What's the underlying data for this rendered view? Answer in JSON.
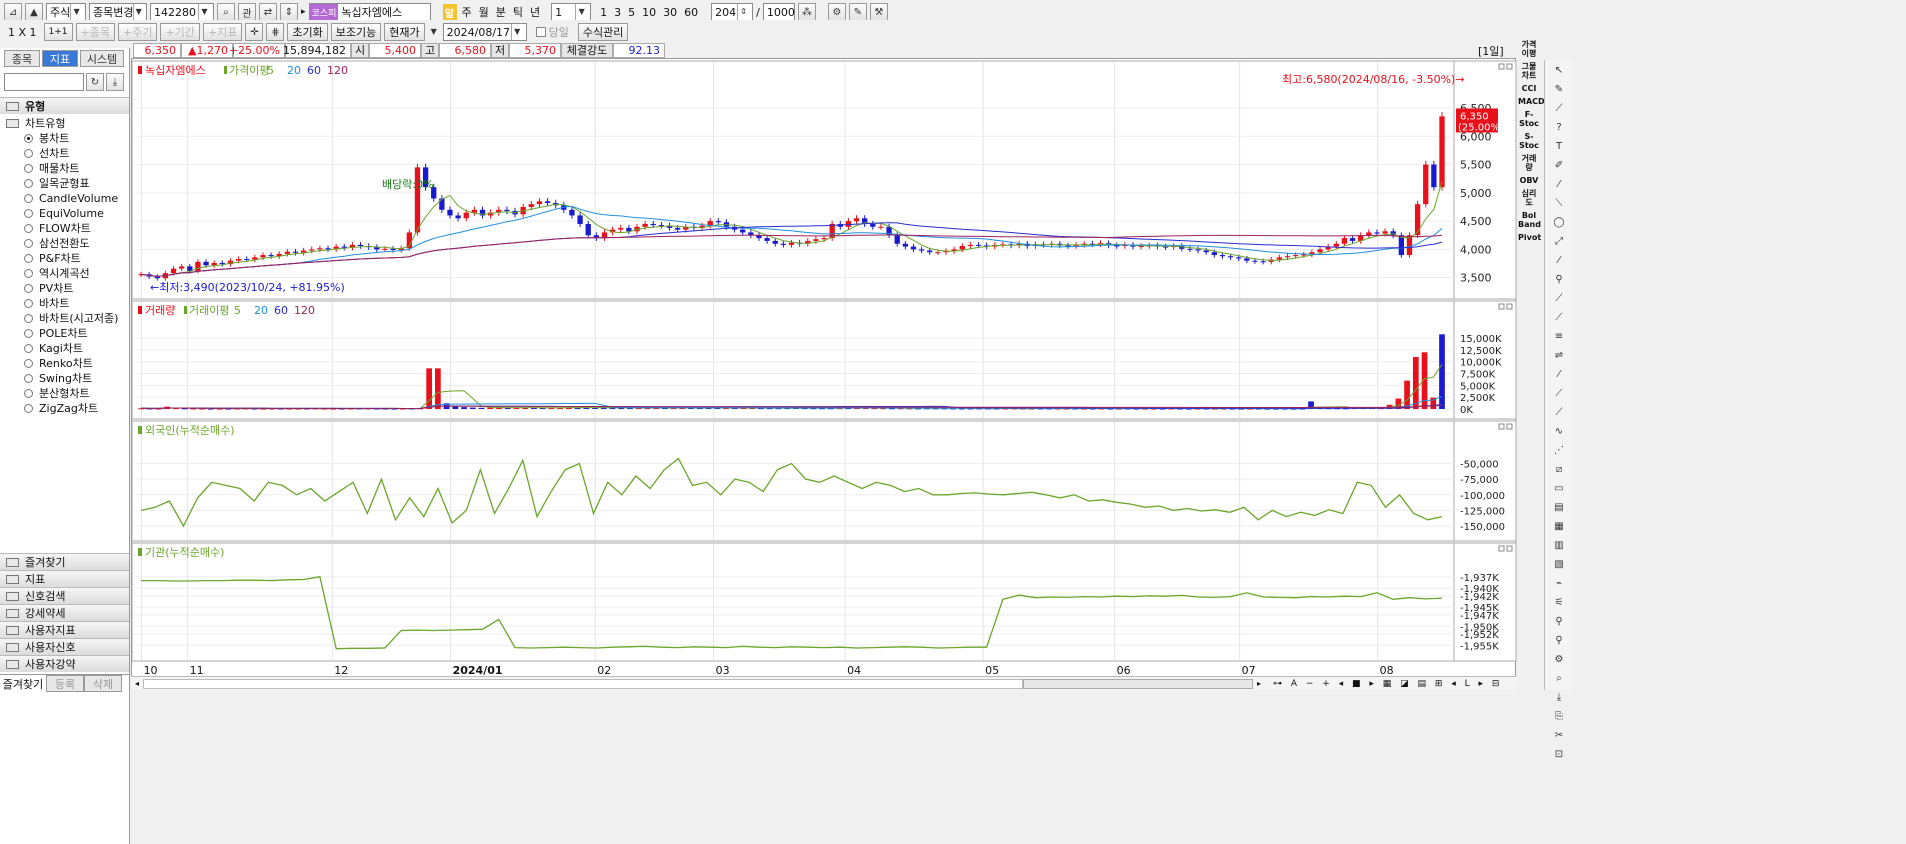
{
  "toolbar1": {
    "market": "주식",
    "code_change": "종목변경",
    "code": "142280",
    "related": "관",
    "market_tag": "코스피",
    "stock_name": "녹십자엠에스",
    "alert_tag": "알",
    "periods": [
      "주",
      "월",
      "분",
      "틱",
      "년"
    ],
    "period_value": "1",
    "intervals": [
      "1",
      "3",
      "5",
      "10",
      "30",
      "60"
    ],
    "count": "204",
    "total": "1000"
  },
  "toolbar2": {
    "layout": "1 X 1",
    "layout2": "1+1",
    "btn_item": "+종목",
    "btn_cycle": "+주기",
    "btn_period": "+기간",
    "btn_indicator": "+지표",
    "reset": "초기화",
    "aux": "보조기능",
    "current": "현재가",
    "date": "2024/08/17",
    "today_label": "당일",
    "formula": "수식관리"
  },
  "left_panel": {
    "tabs": [
      "종목",
      "지표",
      "시스템"
    ],
    "category": "유형",
    "tree_root": "차트유형",
    "chart_types": [
      "봉차트",
      "선차트",
      "매물차트",
      "일목균형표",
      "CandleVolume",
      "EquiVolume",
      "FLOW차트",
      "삼선전환도",
      "P&F차트",
      "역시계곡선",
      "PV차트",
      "바차트",
      "바차트(시고저종)",
      "POLE차트",
      "Kagi차트",
      "Renko차트",
      "Swing차트",
      "분산형차트",
      "ZigZag차트"
    ],
    "selected": "봉차트",
    "accordion": [
      "즐겨찾기",
      "지표",
      "신호검색",
      "강세약세",
      "사용자지표",
      "사용자신호",
      "사용자강약"
    ],
    "bottom_tabs": [
      "즐겨찾기",
      "등록",
      "삭제"
    ]
  },
  "quote": {
    "price": "6,350",
    "change": "▲1,270",
    "rate": "+25.00%",
    "volume": "15,894,182",
    "open_label": "시",
    "open": "5,400",
    "high_label": "고",
    "high": "6,580",
    "low_label": "저",
    "low": "5,370",
    "strength_label": "체결강도",
    "strength": "92.13",
    "period_tag": "[1일]"
  },
  "price_panel": {
    "title": "녹십자엠에스",
    "ma_label": "가격이평",
    "ma_periods": [
      "5",
      "20",
      "60",
      "120"
    ],
    "high_note": "최고:6,580(2024/08/16, -3.50%)→",
    "low_note": "←최저:3,490(2023/10/24, +81.95%)",
    "dividend_note": "배당락:0%",
    "last_price": "6,350",
    "last_rate": "(25.00%)"
  },
  "volume_panel": {
    "title": "거래량",
    "ma_label": "거래이평",
    "ma_periods": [
      "5",
      "20",
      "60",
      "120"
    ]
  },
  "foreign_panel": {
    "title": "외국인(누적순매수)"
  },
  "inst_panel": {
    "title": "기관(누적순매수)"
  },
  "right_labels": [
    "가격이평",
    "그물차트",
    "CCI",
    "MACD",
    "F-Stoc",
    "S-Stoc",
    "거래량",
    "OBV",
    "심리도",
    "Bol Band",
    "Pivot"
  ],
  "colors": {
    "up": "#e8101a",
    "down": "#1a1ad0",
    "ma5": "#6aa62a",
    "ma20": "#1e90e0",
    "ma60": "#2a2ad0",
    "ma120": "#a0205a",
    "accent": "#3a78d8"
  },
  "chart_data": [
    {
      "type": "candlestick",
      "title": "녹십자엠에스",
      "x_ticks": [
        "10",
        "11",
        "12",
        "2024/01",
        "02",
        "03",
        "04",
        "05",
        "06",
        "07",
        "08"
      ],
      "y_ticks": [
        "3,500",
        "4,000",
        "4,500",
        "5,000",
        "5,500",
        "6,000",
        "6,500"
      ],
      "ylim": [
        3300,
        6800
      ],
      "closes": [
        3560,
        3520,
        3490,
        3580,
        3660,
        3700,
        3620,
        3780,
        3720,
        3760,
        3740,
        3800,
        3830,
        3820,
        3860,
        3900,
        3880,
        3920,
        3960,
        3940,
        3980,
        4000,
        4020,
        4000,
        4050,
        4030,
        4080,
        4060,
        4040,
        4000,
        4010,
        3990,
        4020,
        4300,
        5450,
        5100,
        4900,
        4700,
        4600,
        4550,
        4650,
        4700,
        4600,
        4650,
        4700,
        4680,
        4620,
        4750,
        4800,
        4850,
        4820,
        4780,
        4700,
        4600,
        4450,
        4250,
        4200,
        4300,
        4350,
        4380,
        4320,
        4400,
        4450,
        4430,
        4420,
        4380,
        4350,
        4400,
        4380,
        4420,
        4500,
        4480,
        4400,
        4350,
        4300,
        4250,
        4200,
        4150,
        4100,
        4080,
        4120,
        4100,
        4150,
        4180,
        4200,
        4450,
        4400,
        4500,
        4550,
        4450,
        4400,
        4400,
        4250,
        4100,
        4050,
        4000,
        3980,
        3950,
        3950,
        3970,
        4000,
        4060,
        4080,
        4070,
        4050,
        4080,
        4090,
        4070,
        4100,
        4060,
        4090,
        4080,
        4100,
        4070,
        4060,
        4080,
        4100,
        4090,
        4110,
        4070,
        4060,
        4080,
        4050,
        4060,
        4070,
        4050,
        4040,
        4060,
        4010,
        4000,
        3980,
        3950,
        3900,
        3880,
        3860,
        3840,
        3800,
        3790,
        3780,
        3820,
        3860,
        3880,
        3900,
        3910,
        3950,
        4000,
        4050,
        4100,
        4200,
        4150,
        4250,
        4300,
        4280,
        4320,
        4250,
        3900,
        4250,
        4800,
        5500,
        5100,
        6350
      ],
      "ma_colors": [
        "#6aa62a",
        "#1e90e0",
        "#2a2ad0",
        "#a0205a"
      ]
    },
    {
      "type": "bar",
      "title": "거래량",
      "y_ticks": [
        "0K",
        "2,500K",
        "5,000K",
        "7,500K",
        "10,000K",
        "12,500K",
        "15,000K"
      ],
      "ylim": [
        0,
        16500
      ],
      "values": [
        150,
        120,
        100,
        500,
        200,
        150,
        120,
        100,
        90,
        80,
        90,
        100,
        110,
        90,
        80,
        100,
        90,
        80,
        90,
        100,
        110,
        90,
        80,
        90,
        100,
        110,
        120,
        100,
        90,
        80,
        90,
        100,
        150,
        8600,
        8600,
        1200,
        600,
        400,
        300,
        250,
        300,
        350,
        300,
        250,
        280,
        260,
        240,
        300,
        320,
        350,
        300,
        280,
        260,
        250,
        300,
        280,
        260,
        240,
        250,
        230,
        220,
        240,
        260,
        250,
        230,
        220,
        210,
        230,
        240,
        220,
        210,
        200,
        190,
        180,
        200,
        210,
        190,
        180,
        170,
        160,
        180,
        600,
        250,
        220,
        200,
        180,
        170,
        160,
        150,
        140,
        160,
        150,
        140,
        130,
        120,
        130,
        140,
        130,
        120,
        110,
        130,
        120,
        110,
        120,
        130,
        120,
        110,
        120,
        100,
        110,
        120,
        100,
        110,
        120,
        100,
        110,
        90,
        100,
        110,
        100,
        90,
        100,
        110,
        90,
        100,
        90,
        80,
        90,
        100,
        90,
        80,
        90,
        80,
        90,
        1600,
        200,
        180,
        160,
        150,
        200,
        300,
        250,
        200,
        900,
        2200,
        6000,
        11000,
        12000,
        2400,
        15800
      ],
      "up_flags": [
        1,
        0,
        1,
        1,
        1,
        0,
        1,
        1,
        0,
        1,
        0,
        1,
        1,
        0,
        1,
        1,
        0,
        1,
        1,
        0,
        1,
        1,
        1,
        0,
        1,
        0,
        1,
        0,
        0,
        0,
        1,
        0,
        1,
        1,
        1,
        0,
        0,
        0,
        0,
        0,
        1,
        1,
        0,
        1,
        1,
        0,
        0,
        1,
        1,
        1,
        0,
        0,
        0,
        0,
        0,
        0,
        0,
        1,
        1,
        1,
        0,
        1,
        1,
        0,
        0,
        0,
        0,
        1,
        0,
        1,
        1,
        0,
        0,
        0,
        0,
        0,
        0,
        0,
        0,
        0,
        1,
        0,
        1,
        1,
        1,
        1,
        0,
        1,
        1,
        0,
        0,
        0,
        0,
        0,
        0,
        0,
        0,
        0,
        0,
        1,
        1,
        1,
        1,
        0,
        0,
        1,
        1,
        0,
        1,
        0,
        1,
        0,
        1,
        0,
        0,
        1,
        1,
        0,
        1,
        0,
        0,
        1,
        0,
        1,
        1,
        0,
        0,
        1,
        0,
        0,
        0,
        0,
        0,
        0,
        0,
        0,
        0,
        0,
        0,
        1,
        1,
        1,
        1,
        1,
        1,
        1,
        1,
        1,
        1,
        0,
        1,
        1,
        0,
        1,
        0,
        0,
        1,
        1,
        1,
        0,
        1
      ]
    },
    {
      "type": "line",
      "title": "외국인(누적순매수)",
      "y_ticks": [
        "-50,000",
        "-75,000",
        "-100,000",
        "-125,000",
        "-150,000"
      ],
      "ylim": [
        -158000,
        -30000
      ],
      "values": [
        -125000,
        -120000,
        -110000,
        -150000,
        -105000,
        -80000,
        -85000,
        -90000,
        -110000,
        -80000,
        -85000,
        -100000,
        -90000,
        -110000,
        -95000,
        -80000,
        -130000,
        -75000,
        -140000,
        -105000,
        -135000,
        -90000,
        -145000,
        -125000,
        -60000,
        -130000,
        -90000,
        -45000,
        -135000,
        -95000,
        -60000,
        -50000,
        -130000,
        -80000,
        -100000,
        -70000,
        -90000,
        -60000,
        -42000,
        -85000,
        -80000,
        -100000,
        -75000,
        -80000,
        -95000,
        -60000,
        -50000,
        -75000,
        -80000,
        -70000,
        -80000,
        -90000,
        -80000,
        -85000,
        -95000,
        -90000,
        -100000,
        -100000,
        -98000,
        -97000,
        -99000,
        -100000,
        -98000,
        -96000,
        -100000,
        -105000,
        -100000,
        -110000,
        -108000,
        -112000,
        -115000,
        -120000,
        -118000,
        -125000,
        -122000,
        -126000,
        -124000,
        -128000,
        -120000,
        -140000,
        -125000,
        -135000,
        -128000,
        -133000,
        -124000,
        -130000,
        -80000,
        -85000,
        -120000,
        -100000,
        -130000,
        -140000,
        -135000
      ],
      "color": "#6aa62a"
    },
    {
      "type": "line",
      "title": "기관(누적순매수)",
      "y_ticks": [
        "-1,937K",
        "-1,940K",
        "-1,942K",
        "-1,945K",
        "-1,947K",
        "-1,950K",
        "-1,952K",
        "-1,955K"
      ],
      "ylim": [
        -1956500,
        -1936000
      ],
      "values": [
        -1938000,
        -1938000,
        -1938100,
        -1938100,
        -1938000,
        -1938000,
        -1937900,
        -1937900,
        -1938000,
        -1937800,
        -1937700,
        -1937000,
        -1955900,
        -1955800,
        -1955800,
        -1955700,
        -1951100,
        -1951000,
        -1951100,
        -1951000,
        -1950900,
        -1950800,
        -1948200,
        -1955600,
        -1955700,
        -1955600,
        -1955500,
        -1955600,
        -1955700,
        -1955500,
        -1955400,
        -1955300,
        -1955500,
        -1955600,
        -1955400,
        -1955500,
        -1955600,
        -1955300,
        -1955500,
        -1955600,
        -1955400,
        -1955500,
        -1955600,
        -1955500,
        -1955700,
        -1955600,
        -1955500,
        -1955400,
        -1955500,
        -1955700,
        -1955600,
        -1955500,
        -1955500,
        -1942900,
        -1941800,
        -1942500,
        -1942300,
        -1942400,
        -1942200,
        -1942300,
        -1942100,
        -1942200,
        -1942000,
        -1942100,
        -1941900,
        -1942300,
        -1942400,
        -1942200,
        -1941200,
        -1942300,
        -1942400,
        -1942500,
        -1942200,
        -1942300,
        -1942100,
        -1942200,
        -1941200,
        -1942900,
        -1942500,
        -1942800,
        -1942600
      ],
      "color": "#6aa62a"
    }
  ]
}
